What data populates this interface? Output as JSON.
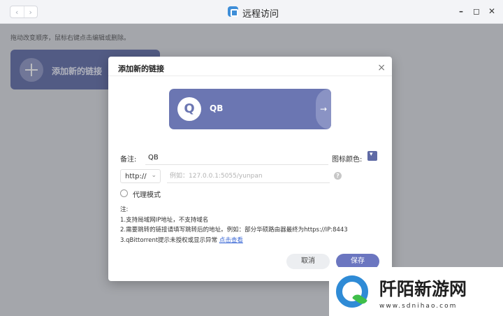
{
  "window": {
    "title": "远程访问",
    "nav_back": "‹",
    "nav_forward": "›",
    "controls": {
      "minimize": "–",
      "maximize": "◻",
      "close": "✕"
    }
  },
  "main": {
    "hint": "拖动改变顺序，鼠标右键点击编辑或删除。",
    "add_tile_label": "添加新的链接"
  },
  "dialog": {
    "title": "添加新的链接",
    "close_glyph": "×",
    "preview": {
      "letter": "Q",
      "label": "QB",
      "arrow": "→"
    },
    "note_label": "备注:",
    "note_value": "QB",
    "icon_color_label": "图标颜色:",
    "icon_color": "#5f6aa5",
    "protocol_value": "http://",
    "url_placeholder": "例如：127.0.0.1:5055/yunpan",
    "help_glyph": "?",
    "proxy_label": "代理模式",
    "notes_title": "注:",
    "note_1": "1.支持局域网IP地址，不支持域名",
    "note_2": "2.需要跳转的链接请填写跳转后的地址。例如：部分华硕路由器最终为https://IP:8443",
    "note_3_prefix": "3.qBittorrent提示未授权或显示异常 ",
    "note_3_link": "点击查看",
    "cancel_label": "取消",
    "save_label": "保存"
  },
  "watermark": {
    "title": "阡陌新游网",
    "url": "www.sdnihao.com"
  }
}
